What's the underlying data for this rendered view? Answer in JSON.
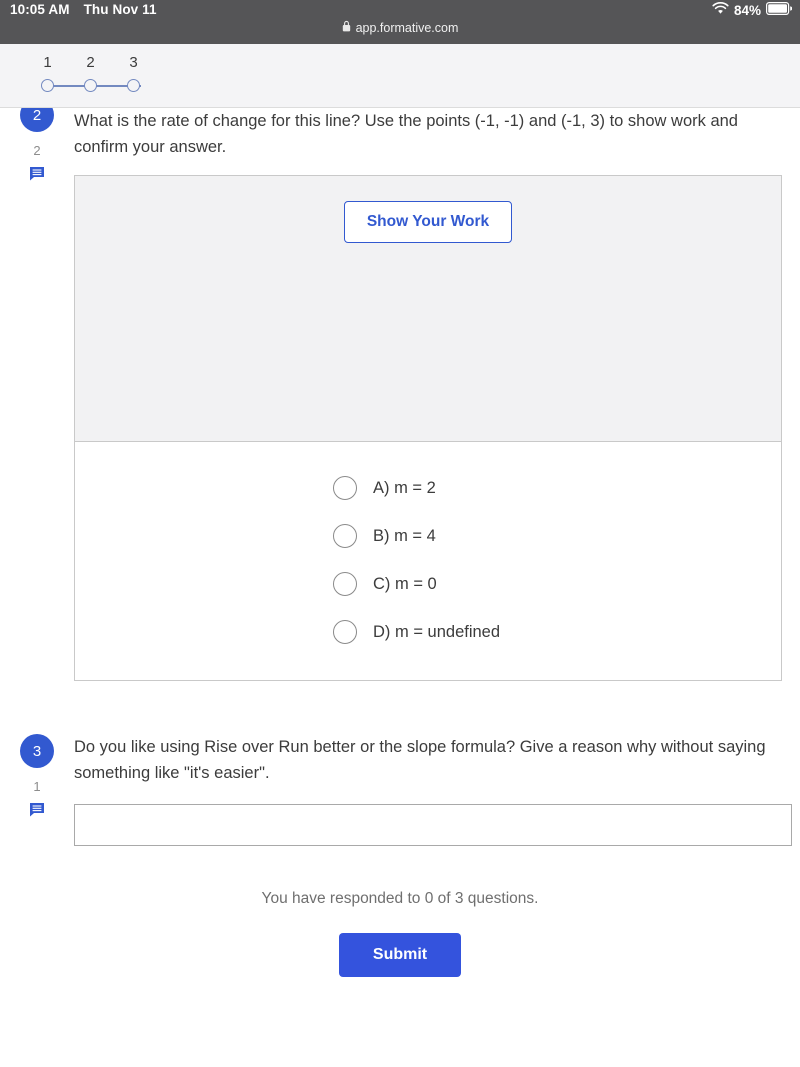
{
  "status_bar": {
    "time": "10:05 AM",
    "date": "Thu Nov 11",
    "battery_percent": "84%",
    "url": "app.formative.com",
    "wifi_icon": "wifi-icon",
    "lock_icon": "lock-icon",
    "battery_icon": "battery-icon"
  },
  "step_nav": {
    "steps": [
      {
        "label": "1"
      },
      {
        "label": "2"
      },
      {
        "label": "3"
      }
    ]
  },
  "questions": [
    {
      "number": "2",
      "points": "2",
      "comment_icon": "comment-icon",
      "text": "What is the rate of change for this line? Use the points (-1, -1) and (-1, 3) to show work and confirm your answer.",
      "show_work_label": "Show Your Work",
      "options": [
        {
          "label": "A) m = 2"
        },
        {
          "label": "B) m = 4"
        },
        {
          "label": "C) m = 0"
        },
        {
          "label": "D) m = undefined"
        }
      ]
    },
    {
      "number": "3",
      "points": "1",
      "comment_icon": "comment-icon",
      "text": "Do you like using Rise over Run better or the slope formula? Give a reason why without saying something like \"it's easier\".",
      "answer_value": "",
      "answer_placeholder": ""
    }
  ],
  "footer": {
    "responded_text": "You have responded to 0 of 3 questions.",
    "submit_label": "Submit"
  },
  "colors": {
    "accent_blue": "#3259d0",
    "submit_blue": "#3453dd",
    "status_bar_gray": "#555557",
    "nav_bg": "#f4f4f6",
    "work_area_bg": "#f2f2f3"
  }
}
